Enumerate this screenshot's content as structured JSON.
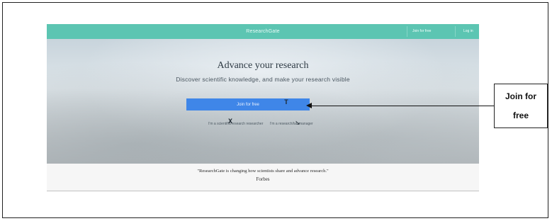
{
  "header": {
    "brand": "ResearchGate",
    "nav": [
      {
        "label": "Join for free"
      },
      {
        "label": "Log in"
      }
    ]
  },
  "hero": {
    "title": "Advance your research",
    "subtitle": "Discover scientific knowledge, and make your research visible",
    "cta_label": "Join for free",
    "links": [
      {
        "label": "I'm a scientific/research researcher"
      },
      {
        "label": "I'm a research/lab manager"
      }
    ]
  },
  "quote": {
    "text": "\"ResearchGate is changing how scientists share and advance research.\"",
    "author": "Forbes"
  },
  "annotation": {
    "line1": "Join for",
    "line2": "free"
  },
  "colors": {
    "header": "#5cc5b2",
    "cta": "#3f86e8"
  }
}
